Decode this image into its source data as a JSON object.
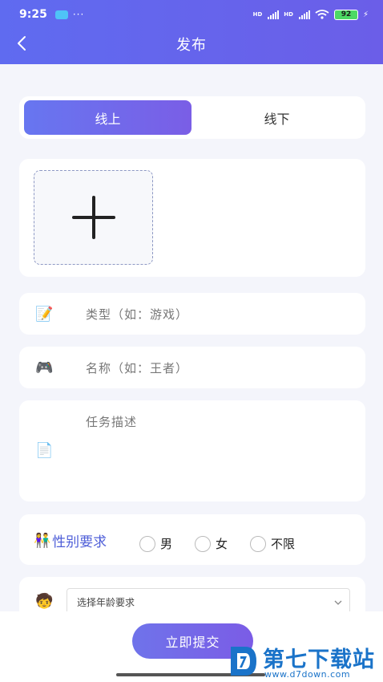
{
  "status_bar": {
    "time": "9:25",
    "more": "···",
    "network1": "HD",
    "network2": "HD",
    "battery": "92"
  },
  "header": {
    "title": "发布",
    "back_icon": "chevron-left-icon"
  },
  "mode_toggle": {
    "online_label": "线上",
    "offline_label": "线下",
    "selected": "线上"
  },
  "upload": {
    "icon": "plus-icon"
  },
  "form": {
    "type": {
      "icon": "memo-icon",
      "emoji": "📝",
      "placeholder": "类型（如：游戏）"
    },
    "name": {
      "icon": "gamepad-icon",
      "emoji": "🎮",
      "placeholder": "名称（如：王者）"
    },
    "description": {
      "icon": "document-icon",
      "emoji": "📄",
      "placeholder": "任务描述"
    },
    "gender": {
      "icon": "couple-icon",
      "emoji": "👫",
      "label": "性别要求",
      "options": [
        "男",
        "女",
        "不限"
      ]
    },
    "age": {
      "icon": "child-icon",
      "emoji": "🧒",
      "placeholder": "选择年龄要求"
    }
  },
  "submit_label": "立即提交",
  "watermark": {
    "name": "第七下载站",
    "url": "www.d7down.com"
  },
  "colors": {
    "accent": "#6a6cf0",
    "accent_end": "#7b5ce6",
    "background": "#f4f5fb",
    "watermark": "#1a73c9"
  }
}
